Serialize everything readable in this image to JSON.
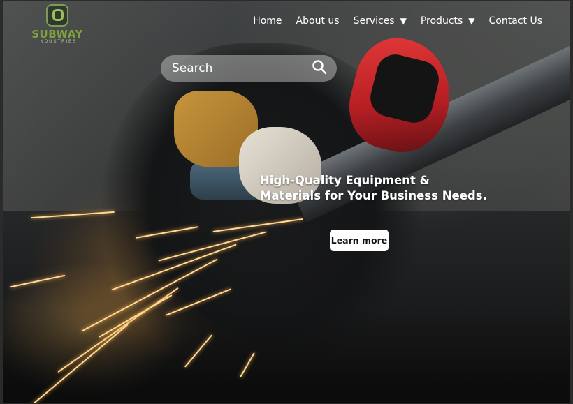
{
  "brand": {
    "name": "SUBWAY",
    "tagline": "INDUSTRIES",
    "accent_color": "#7ea33e"
  },
  "nav": {
    "items": [
      {
        "label": "Home",
        "has_dropdown": false
      },
      {
        "label": "About us",
        "has_dropdown": false
      },
      {
        "label": "Services",
        "has_dropdown": true
      },
      {
        "label": "Products",
        "has_dropdown": true
      },
      {
        "label": "Contact Us",
        "has_dropdown": false
      }
    ],
    "dropdown_icon": "caret-down-icon"
  },
  "search": {
    "placeholder": "Search",
    "value": "",
    "icon": "search-icon"
  },
  "hero": {
    "headline_line1": "High-Quality Equipment &",
    "headline_line2": "Materials for Your Business Needs.",
    "cta_label": "Learn more"
  }
}
